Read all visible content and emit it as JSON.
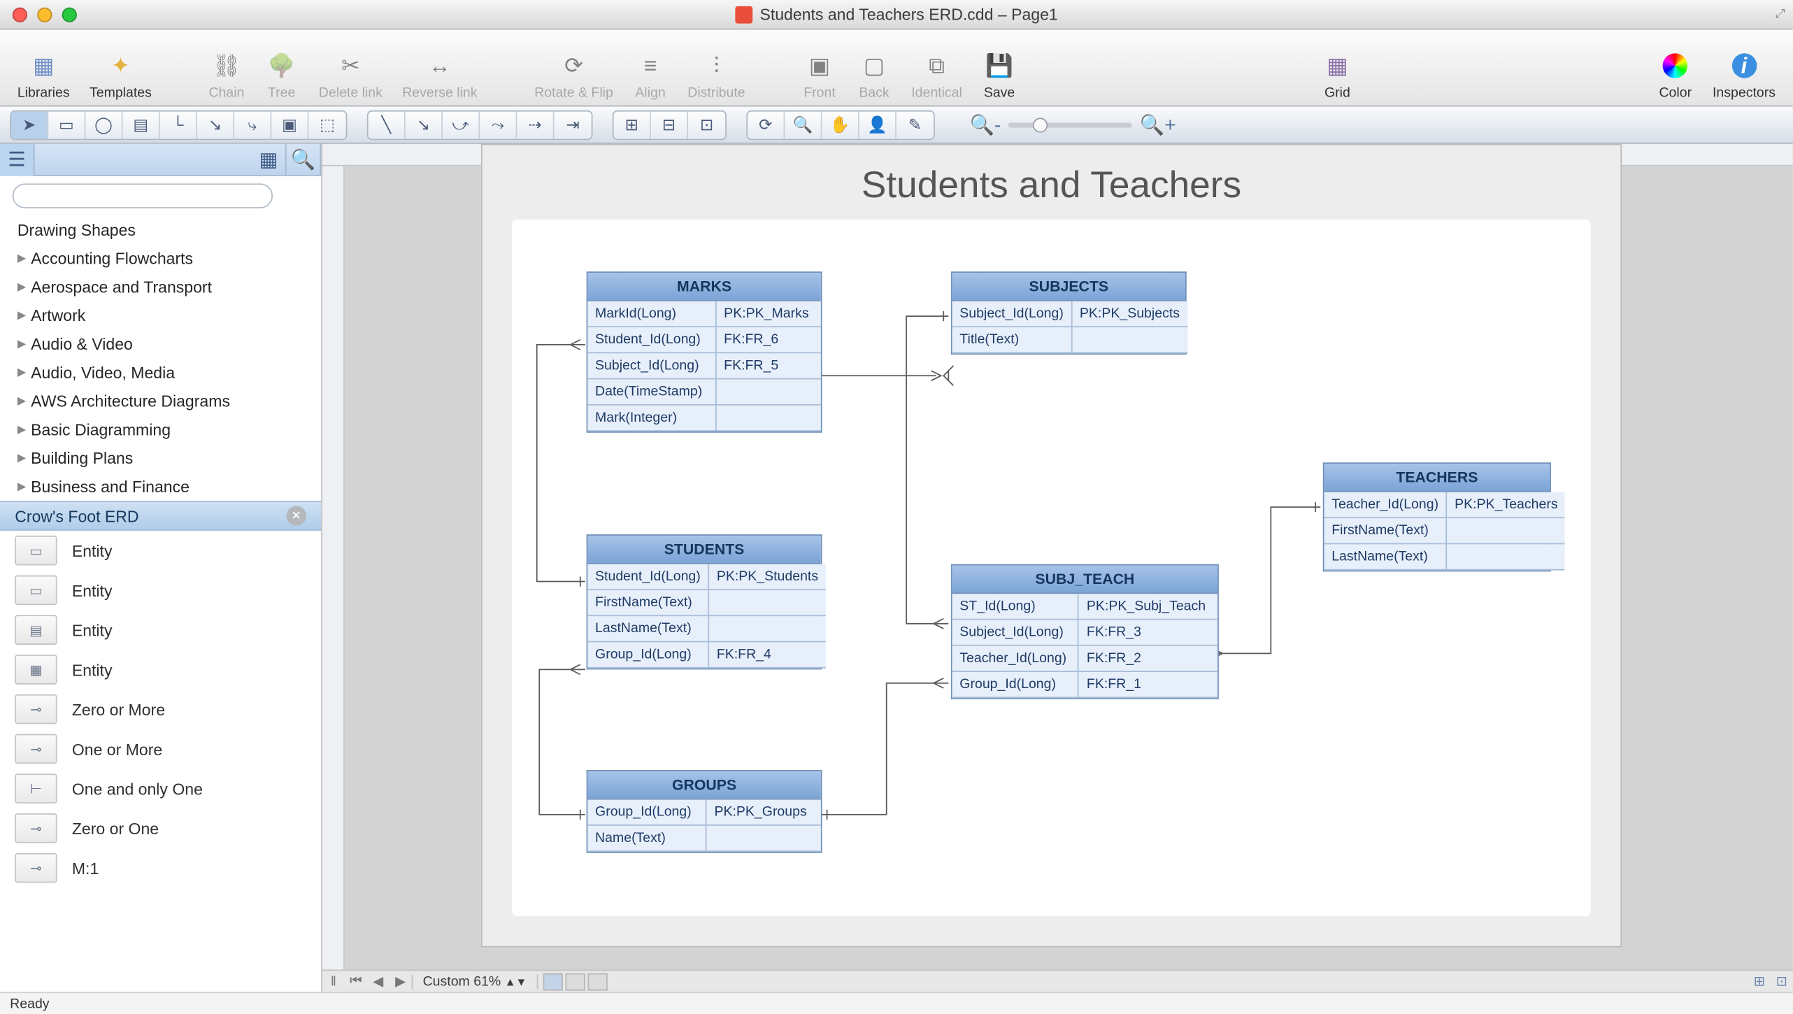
{
  "window": {
    "title": "Students and Teachers ERD.cdd – Page1"
  },
  "toolbar": {
    "libraries": "Libraries",
    "templates": "Templates",
    "chain": "Chain",
    "tree": "Tree",
    "delete_link": "Delete link",
    "reverse_link": "Reverse link",
    "rotate_flip": "Rotate & Flip",
    "align": "Align",
    "distribute": "Distribute",
    "front": "Front",
    "back": "Back",
    "identical": "Identical",
    "save": "Save",
    "grid": "Grid",
    "color": "Color",
    "inspectors": "Inspectors"
  },
  "sidebar": {
    "heading": "Drawing Shapes",
    "categories": [
      "Accounting Flowcharts",
      "Aerospace and Transport",
      "Artwork",
      "Audio & Video",
      "Audio, Video, Media",
      "AWS Architecture Diagrams",
      "Basic Diagramming",
      "Building Plans",
      "Business and Finance"
    ],
    "active_lib": "Crow's Foot ERD",
    "shapes": [
      {
        "label": "Entity"
      },
      {
        "label": "Entity"
      },
      {
        "label": "Entity"
      },
      {
        "label": "Entity"
      },
      {
        "label": "Zero or More"
      },
      {
        "label": "One or More"
      },
      {
        "label": "One and only One"
      },
      {
        "label": "Zero or One"
      },
      {
        "label": "M:1"
      }
    ]
  },
  "diagram": {
    "title": "Students and Teachers",
    "entities": {
      "marks": {
        "name": "MARKS",
        "rows": [
          [
            "MarkId(Long)",
            "PK:PK_Marks"
          ],
          [
            "Student_Id(Long)",
            "FK:FR_6"
          ],
          [
            "Subject_Id(Long)",
            "FK:FR_5"
          ],
          [
            "Date(TimeStamp)",
            ""
          ],
          [
            "Mark(Integer)",
            ""
          ]
        ]
      },
      "subjects": {
        "name": "SUBJECTS",
        "rows": [
          [
            "Subject_Id(Long)",
            "PK:PK_Subjects"
          ],
          [
            "Title(Text)",
            ""
          ]
        ]
      },
      "students": {
        "name": "STUDENTS",
        "rows": [
          [
            "Student_Id(Long)",
            "PK:PK_Students"
          ],
          [
            "FirstName(Text)",
            ""
          ],
          [
            "LastName(Text)",
            ""
          ],
          [
            "Group_Id(Long)",
            "FK:FR_4"
          ]
        ]
      },
      "subj_teach": {
        "name": "SUBJ_TEACH",
        "rows": [
          [
            "ST_Id(Long)",
            "PK:PK_Subj_Teach"
          ],
          [
            "Subject_Id(Long)",
            "FK:FR_3"
          ],
          [
            "Teacher_Id(Long)",
            "FK:FR_2"
          ],
          [
            "Group_Id(Long)",
            "FK:FR_1"
          ]
        ]
      },
      "teachers": {
        "name": "TEACHERS",
        "rows": [
          [
            "Teacher_Id(Long)",
            "PK:PK_Teachers"
          ],
          [
            "FirstName(Text)",
            ""
          ],
          [
            "LastName(Text)",
            ""
          ]
        ]
      },
      "groups": {
        "name": "GROUPS",
        "rows": [
          [
            "Group_Id(Long)",
            "PK:PK_Groups"
          ],
          [
            "Name(Text)",
            ""
          ]
        ]
      }
    }
  },
  "footer": {
    "zoom": "Custom 61%",
    "status": "Ready"
  }
}
